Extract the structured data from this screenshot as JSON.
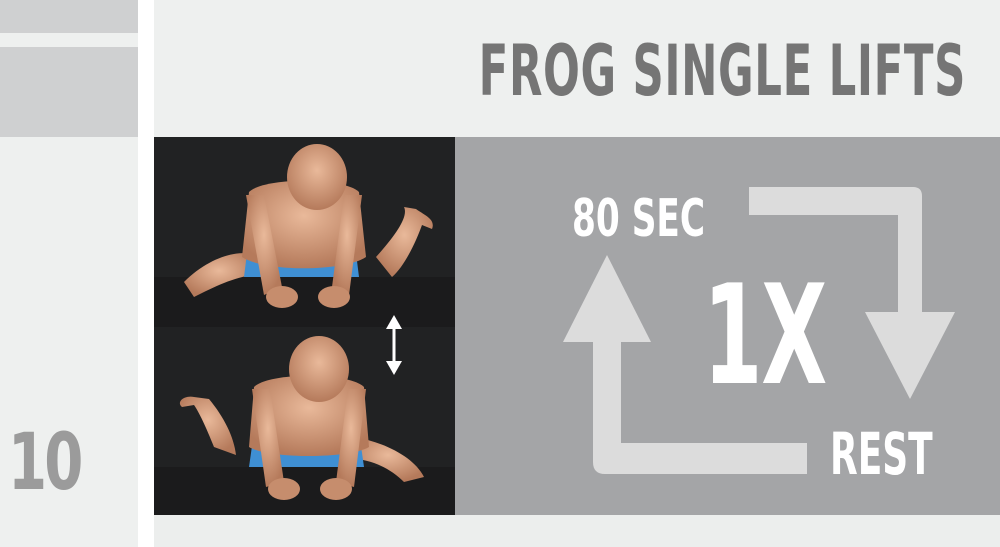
{
  "exercise": {
    "number": "10",
    "title": "FROG SINGLE LIFTS"
  },
  "cycle": {
    "duration": "80 SEC",
    "rounds": "1X",
    "rest": "REST"
  },
  "photo": {
    "description_icon": "up-down-arrow-icon"
  },
  "colors": {
    "panel_grey": "#a4a5a7",
    "title_grey": "#757575",
    "number_grey": "#9b9b9b",
    "arrow_light": "#dcdcdc",
    "background": "#eceeed"
  }
}
